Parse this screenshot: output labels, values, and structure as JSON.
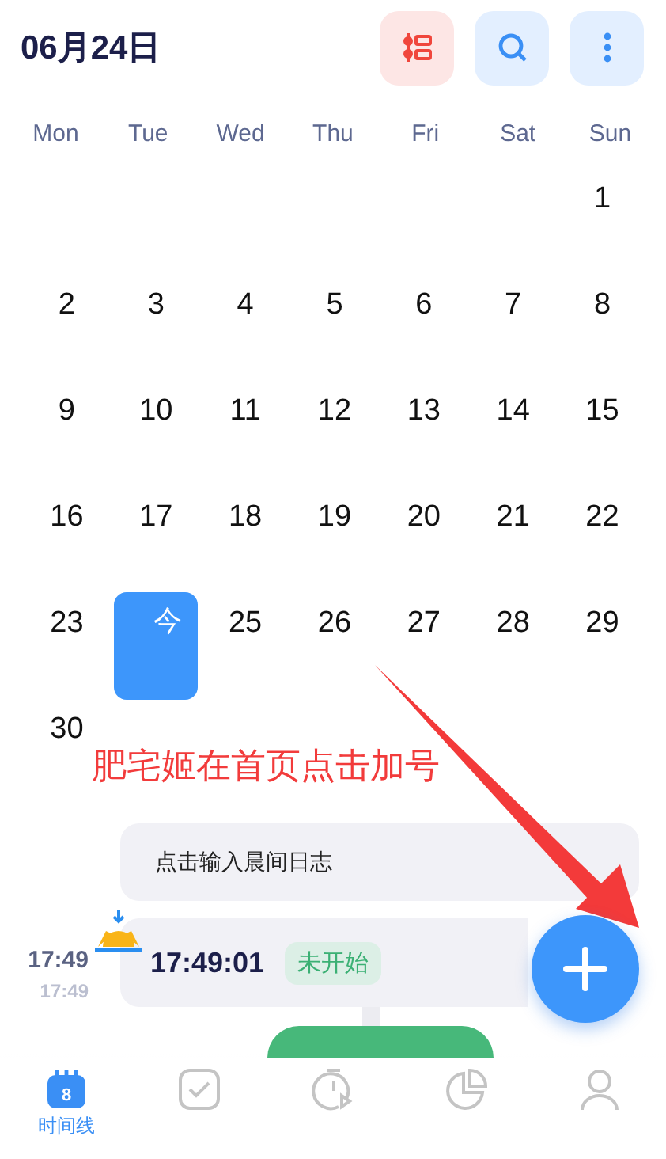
{
  "header": {
    "title": "06月24日"
  },
  "weekdays": [
    "Mon",
    "Tue",
    "Wed",
    "Thu",
    "Fri",
    "Sat",
    "Sun"
  ],
  "weeks": [
    [
      {
        "text": "1",
        "selected": false
      }
    ],
    [
      {
        "text": "2",
        "selected": false
      },
      {
        "text": "3",
        "selected": false
      },
      {
        "text": "4",
        "selected": false
      },
      {
        "text": "5",
        "selected": false
      },
      {
        "text": "6",
        "selected": false
      },
      {
        "text": "7",
        "selected": false
      },
      {
        "text": "8",
        "selected": false
      }
    ],
    [
      {
        "text": "9",
        "selected": false
      },
      {
        "text": "10",
        "selected": false
      },
      {
        "text": "11",
        "selected": false
      },
      {
        "text": "12",
        "selected": false
      },
      {
        "text": "13",
        "selected": false
      },
      {
        "text": "14",
        "selected": false
      },
      {
        "text": "15",
        "selected": false
      }
    ],
    [
      {
        "text": "16",
        "selected": false
      },
      {
        "text": "17",
        "selected": false
      },
      {
        "text": "18",
        "selected": false
      },
      {
        "text": "19",
        "selected": false
      },
      {
        "text": "20",
        "selected": false
      },
      {
        "text": "21",
        "selected": false
      },
      {
        "text": "22",
        "selected": false
      }
    ],
    [
      {
        "text": "23",
        "selected": false
      },
      {
        "text": "今",
        "selected": true
      },
      {
        "text": "25",
        "selected": false
      },
      {
        "text": "26",
        "selected": false
      },
      {
        "text": "27",
        "selected": false
      },
      {
        "text": "28",
        "selected": false
      },
      {
        "text": "29",
        "selected": false
      }
    ],
    [
      {
        "text": "30",
        "selected": false
      }
    ]
  ],
  "annotation": {
    "text": "肥宅姬在首页点击加号"
  },
  "timeline": {
    "journal_placeholder": "点击输入晨间日志",
    "time": "17:49",
    "time_sub": "17:49",
    "entry_time": "17:49:01",
    "status": "未开始"
  },
  "nav": [
    {
      "kind": "calendar",
      "label": "时间线",
      "badge": "8",
      "selected": true
    },
    {
      "kind": "check",
      "selected": false
    },
    {
      "kind": "timer",
      "selected": false
    },
    {
      "kind": "pie",
      "selected": false
    },
    {
      "kind": "person",
      "selected": false
    }
  ]
}
